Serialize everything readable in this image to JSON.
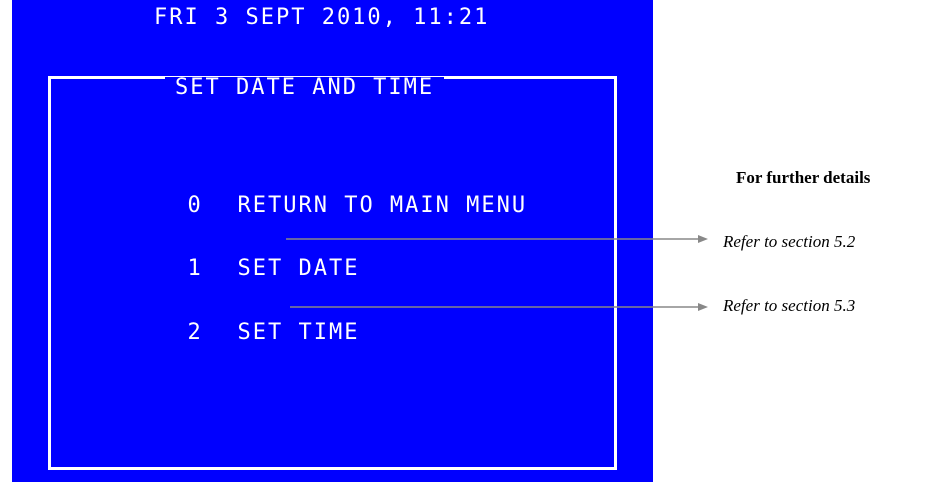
{
  "screen": {
    "datetime": "FRI 3 SEPT 2010, 11:21",
    "title": "SET DATE AND TIME",
    "menu_items": [
      {
        "number": "0",
        "label": "RETURN TO MAIN MENU"
      },
      {
        "number": "1",
        "label": "SET DATE"
      },
      {
        "number": "2",
        "label": "SET TIME"
      }
    ],
    "colors": {
      "background": "#0000ff",
      "text": "#ffffff"
    }
  },
  "sidebar": {
    "header": "For further details",
    "refs": [
      "Refer to section 5.2",
      "Refer to section 5.3"
    ]
  }
}
